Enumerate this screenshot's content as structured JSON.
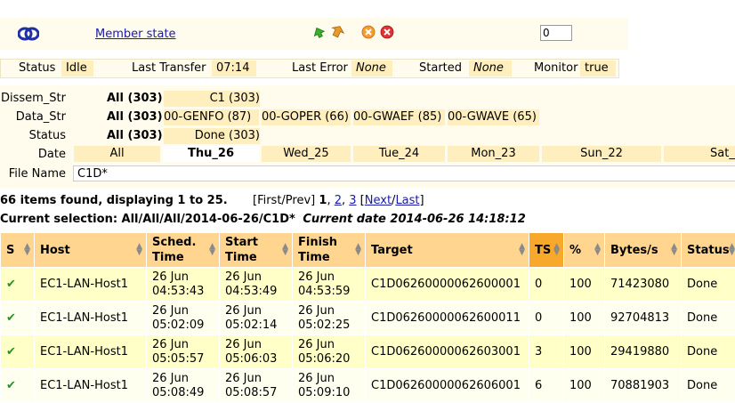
{
  "header": {
    "link_label": "Member state",
    "count_value": "0"
  },
  "status": {
    "items": [
      {
        "label": "Status",
        "value": "Idle"
      },
      {
        "label": "Last Transfer",
        "value": "07:14"
      },
      {
        "label": "Last Error",
        "value": "None"
      },
      {
        "label": "Started",
        "value": "None"
      },
      {
        "label": "Monitor",
        "value": "true"
      }
    ]
  },
  "filters": {
    "dissem": {
      "label": "Dissem_Str",
      "all": "All (303)",
      "values": [
        "C1 (303)"
      ]
    },
    "data": {
      "label": "Data_Str",
      "all": "All (303)",
      "values": [
        "00-GENFO (87)",
        "00-GOPER (66)",
        "00-GWAEF (85)",
        "00-GWAVE (65)"
      ]
    },
    "status": {
      "label": "Status",
      "all": "All (303)",
      "values": [
        "Done (303)"
      ]
    },
    "date": {
      "label": "Date",
      "values": [
        "All",
        "Thu_26",
        "Wed_25",
        "Tue_24",
        "Mon_23",
        "Sun_22",
        "Sat_"
      ]
    },
    "file": {
      "label": "File Name",
      "value": "C1D*"
    }
  },
  "results": {
    "summary": "66 items found, displaying 1 to 25.",
    "pager": {
      "prev": "[First/Prev]",
      "current": "1",
      "p2": "2",
      "p3": "3",
      "next": "Next",
      "last": "Last"
    },
    "selection_label": "Current selection: All/All/All/2014-06-26/C1D*",
    "current_date": "Current date 2014-06-26 14:18:12"
  },
  "table": {
    "columns": [
      "S",
      "Host",
      "Sched. Time",
      "Start Time",
      "Finish Time",
      "Target",
      "TS",
      "%",
      "Bytes/s",
      "Status"
    ],
    "rows": [
      {
        "host": "EC1-LAN-Host1",
        "sched": [
          "26 Jun",
          "04:53:43"
        ],
        "start": [
          "26 Jun",
          "04:53:49"
        ],
        "finish": [
          "26 Jun",
          "04:53:59"
        ],
        "target": "C1D06260000062600001",
        "ts": "0",
        "pct": "100",
        "bps": "71423080",
        "status": "Done"
      },
      {
        "host": "EC1-LAN-Host1",
        "sched": [
          "26 Jun",
          "05:02:09"
        ],
        "start": [
          "26 Jun",
          "05:02:14"
        ],
        "finish": [
          "26 Jun",
          "05:02:25"
        ],
        "target": "C1D06260000062600011",
        "ts": "0",
        "pct": "100",
        "bps": "92704813",
        "status": "Done"
      },
      {
        "host": "EC1-LAN-Host1",
        "sched": [
          "26 Jun",
          "05:05:57"
        ],
        "start": [
          "26 Jun",
          "05:06:03"
        ],
        "finish": [
          "26 Jun",
          "05:06:20"
        ],
        "target": "C1D06260000062603001",
        "ts": "3",
        "pct": "100",
        "bps": "29419880",
        "status": "Done"
      },
      {
        "host": "EC1-LAN-Host1",
        "sched": [
          "26 Jun",
          "05:08:49"
        ],
        "start": [
          "26 Jun",
          "05:08:57"
        ],
        "finish": [
          "26 Jun",
          "05:09:10"
        ],
        "target": "C1D06260000062606001",
        "ts": "6",
        "pct": "100",
        "bps": "70881903",
        "status": "Done"
      }
    ]
  },
  "icons": {
    "logo": "ecmwf-logo-icon",
    "up": "green-arrow-icon",
    "down": "orange-arrow-icon",
    "stop": "orange-x-icon",
    "delete": "red-x-icon",
    "check": "check-icon"
  }
}
